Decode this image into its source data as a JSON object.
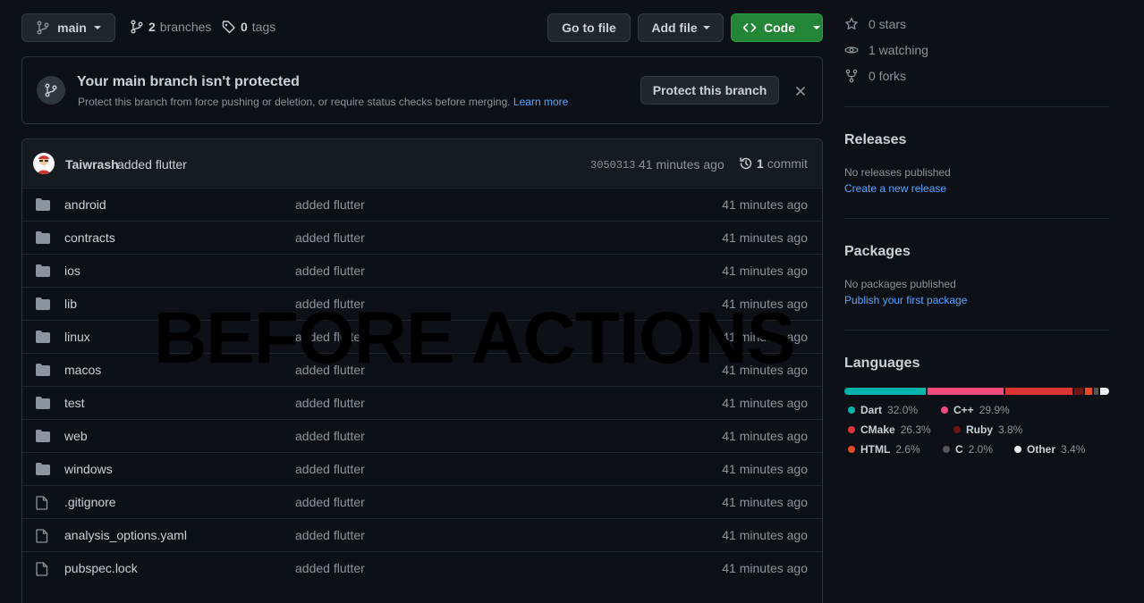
{
  "toolbar": {
    "branch_name": "main",
    "branches_count": "2",
    "branches_label": "branches",
    "tags_count": "0",
    "tags_label": "tags",
    "go_to_file": "Go to file",
    "add_file": "Add file",
    "code": "Code"
  },
  "banner": {
    "title": "Your main branch isn't protected",
    "text": "Protect this branch from force pushing or deletion, or require status checks before merging.",
    "learn_more": "Learn more",
    "protect_button": "Protect this branch"
  },
  "commit": {
    "author": "Taiwrash",
    "message": "added flutter",
    "hash": "3050313",
    "time": "41 minutes ago",
    "count": "1",
    "count_label": "commit"
  },
  "files": [
    {
      "name": "android",
      "type": "folder",
      "message": "added flutter",
      "age": "41 minutes ago"
    },
    {
      "name": "contracts",
      "type": "folder",
      "message": "added flutter",
      "age": "41 minutes ago"
    },
    {
      "name": "ios",
      "type": "folder",
      "message": "added flutter",
      "age": "41 minutes ago"
    },
    {
      "name": "lib",
      "type": "folder",
      "message": "added flutter",
      "age": "41 minutes ago"
    },
    {
      "name": "linux",
      "type": "folder",
      "message": "added flutter",
      "age": "41 minutes ago"
    },
    {
      "name": "macos",
      "type": "folder",
      "message": "added flutter",
      "age": "41 minutes ago"
    },
    {
      "name": "test",
      "type": "folder",
      "message": "added flutter",
      "age": "41 minutes ago"
    },
    {
      "name": "web",
      "type": "folder",
      "message": "added flutter",
      "age": "41 minutes ago"
    },
    {
      "name": "windows",
      "type": "folder",
      "message": "added flutter",
      "age": "41 minutes ago"
    },
    {
      "name": ".gitignore",
      "type": "file",
      "message": "added flutter",
      "age": "41 minutes ago"
    },
    {
      "name": "analysis_options.yaml",
      "type": "file",
      "message": "added flutter",
      "age": "41 minutes ago"
    },
    {
      "name": "pubspec.lock",
      "type": "file",
      "message": "added flutter",
      "age": "41 minutes ago"
    }
  ],
  "sidebar": {
    "stars": "0 stars",
    "watching": "1 watching",
    "forks": "0 forks",
    "releases_title": "Releases",
    "releases_text": "No releases published",
    "releases_link": "Create a new release",
    "packages_title": "Packages",
    "packages_text": "No packages published",
    "packages_link": "Publish your first package",
    "languages_title": "Languages",
    "languages": [
      {
        "name": "Dart",
        "percent": "32.0%",
        "value": 32.0,
        "color": "#00B4AB"
      },
      {
        "name": "C++",
        "percent": "29.9%",
        "value": 29.9,
        "color": "#f34b7d"
      },
      {
        "name": "CMake",
        "percent": "26.3%",
        "value": 26.3,
        "color": "#DA3434"
      },
      {
        "name": "Ruby",
        "percent": "3.8%",
        "value": 3.8,
        "color": "#701516"
      },
      {
        "name": "HTML",
        "percent": "2.6%",
        "value": 2.6,
        "color": "#e34c26"
      },
      {
        "name": "C",
        "percent": "2.0%",
        "value": 2.0,
        "color": "#555555"
      },
      {
        "name": "Other",
        "percent": "3.4%",
        "value": 3.4,
        "color": "#ededed"
      }
    ]
  },
  "overlay": {
    "watermark": "BEFORE ACTIONS"
  }
}
